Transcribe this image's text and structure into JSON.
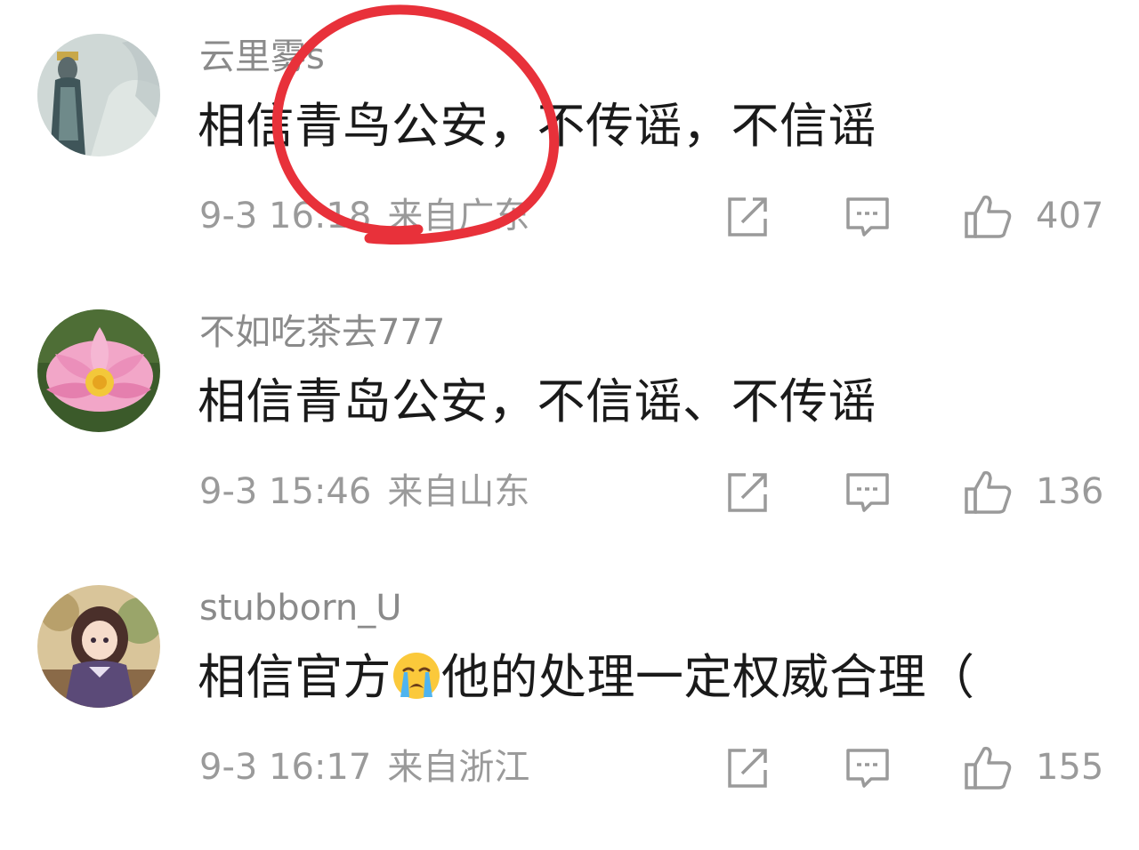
{
  "comments": [
    {
      "username": "云里雾s",
      "text": "相信青鸟公安，不传谣，不信谣",
      "time": "9-3 16:18",
      "location": "来自广东",
      "likes": "407",
      "avatar_icon": "statue-avatar"
    },
    {
      "username": "不如吃茶去777",
      "text": "相信青岛公安，不信谣、不传谣",
      "time": "9-3 15:46",
      "location": "来自山东",
      "likes": "136",
      "avatar_icon": "lotus-avatar"
    },
    {
      "username": "stubborn_U",
      "text_before": "相信官方",
      "emoji": "crying-face-emoji",
      "text_after": "他的处理一定权威合理（",
      "time": "9-3 16:17",
      "location": "来自浙江",
      "likes": "155",
      "avatar_icon": "anime-girl-avatar"
    }
  ],
  "colors": {
    "username": "#8a8a8a",
    "content": "#1a1a1a",
    "meta": "#9a9a9a",
    "icon": "#9a9a9a",
    "annotation_circle": "#e8313a"
  },
  "icons": {
    "share": "share-icon",
    "reply": "comment-icon",
    "like": "thumbs-up-icon"
  }
}
